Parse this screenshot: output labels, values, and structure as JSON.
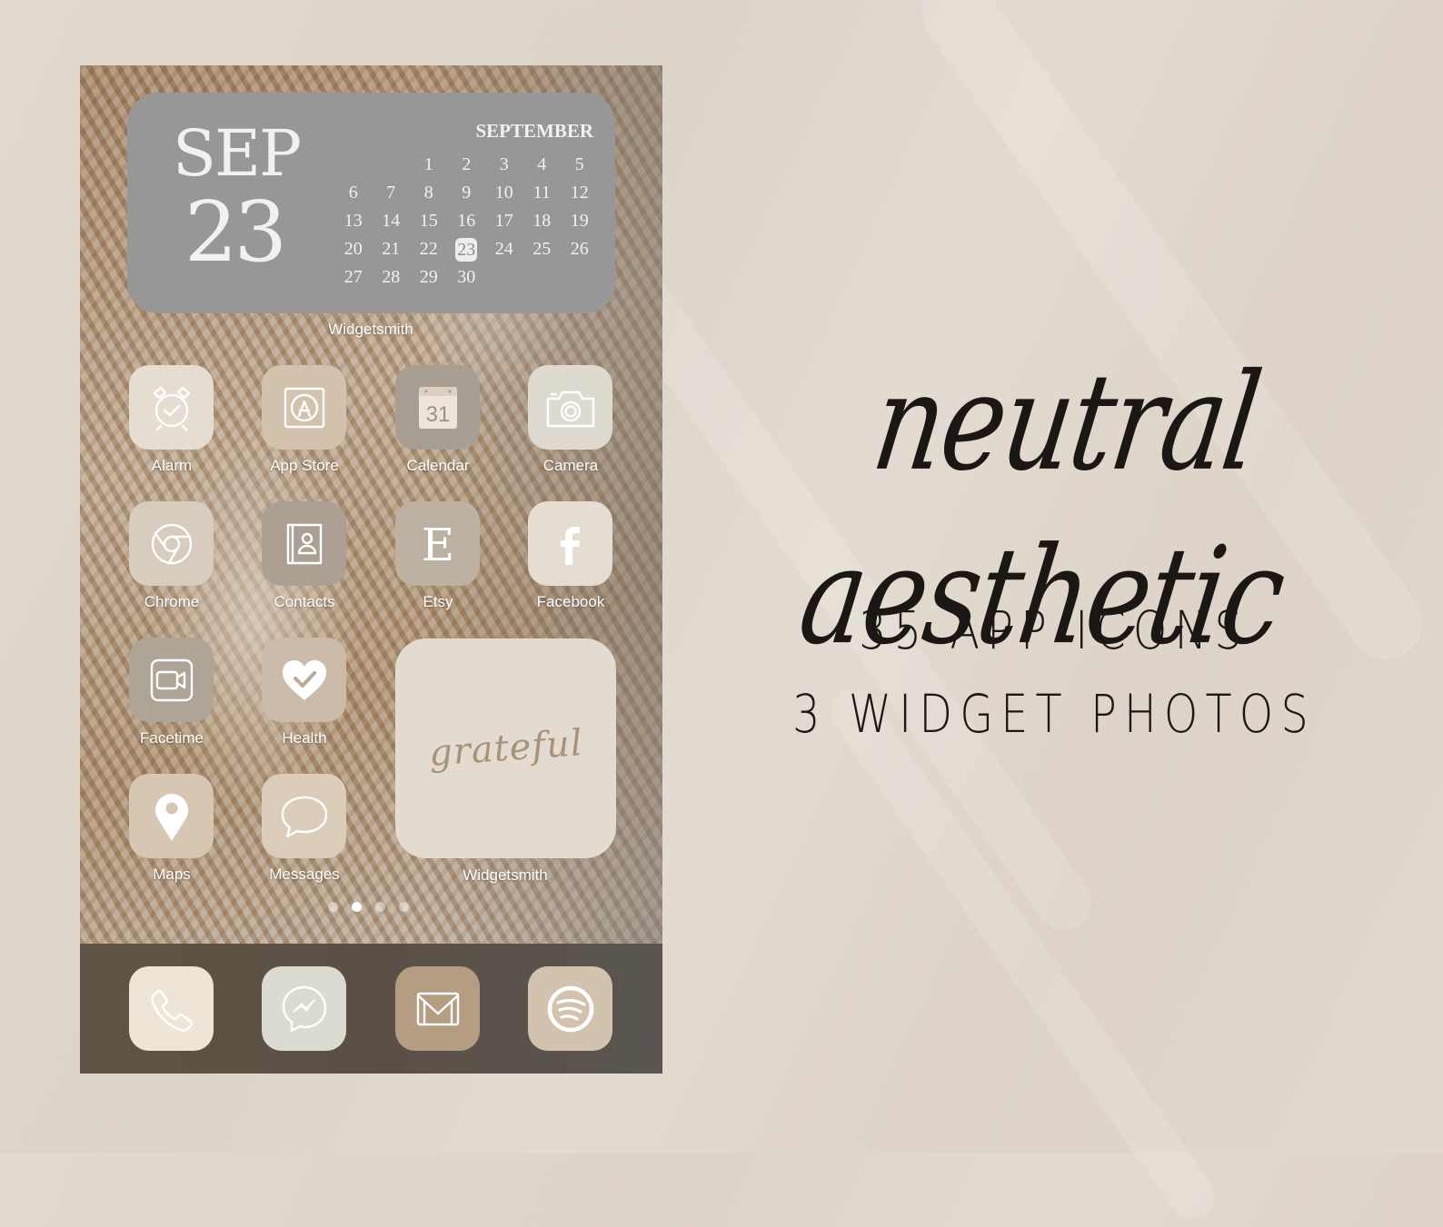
{
  "calendar_widget": {
    "month_short": "SEP",
    "day": "23",
    "month_long": "SEPTEMBER",
    "leading_blanks": 2,
    "days": [
      "1",
      "2",
      "3",
      "4",
      "5",
      "6",
      "7",
      "8",
      "9",
      "10",
      "11",
      "12",
      "13",
      "14",
      "15",
      "16",
      "17",
      "18",
      "19",
      "20",
      "21",
      "22",
      "23",
      "24",
      "25",
      "26",
      "27",
      "28",
      "29",
      "30"
    ],
    "today": "23",
    "label": "Widgetsmith"
  },
  "apps": [
    {
      "label": "Alarm",
      "icon": "alarm-clock-icon",
      "color": "#e6ddd2"
    },
    {
      "label": "App Store",
      "icon": "app-store-icon",
      "color": "#d3c2ac"
    },
    {
      "label": "Calendar",
      "icon": "calendar-icon",
      "color": "#a89f94",
      "glyph": "31"
    },
    {
      "label": "Camera",
      "icon": "camera-icon",
      "color": "#dedad0"
    },
    {
      "label": "Chrome",
      "icon": "chrome-icon",
      "color": "#d7ccbe"
    },
    {
      "label": "Contacts",
      "icon": "contacts-book-icon",
      "color": "#aba093"
    },
    {
      "label": "Etsy",
      "icon": "etsy-icon",
      "color": "#bcb1a3",
      "glyph": "E"
    },
    {
      "label": "Facebook",
      "icon": "facebook-icon",
      "color": "#e6ddd2",
      "glyph": "f"
    },
    {
      "label": "Facetime",
      "icon": "video-camera-icon",
      "color": "#aea596"
    },
    {
      "label": "Health",
      "icon": "heart-check-icon",
      "color": "#cbbba8"
    },
    {
      "label": "Maps",
      "icon": "map-pin-icon",
      "color": "#d7c6b1"
    },
    {
      "label": "Messages",
      "icon": "speech-bubble-icon",
      "color": "#dccdbb"
    }
  ],
  "quote_widget": {
    "text": "grateful",
    "label": "Widgetsmith"
  },
  "page_dots": {
    "count": 4,
    "active_index": 1
  },
  "dock": [
    {
      "name": "Phone",
      "icon": "phone-icon",
      "color": "#eee4d8"
    },
    {
      "name": "Messenger",
      "icon": "messenger-icon",
      "color": "#dcdbd1"
    },
    {
      "name": "Gmail",
      "icon": "mail-icon",
      "color": "#b59d82"
    },
    {
      "name": "Spotify",
      "icon": "spotify-icon",
      "color": "#d3c3ae"
    }
  ],
  "promo": {
    "title": "neutral aesthetic",
    "line1": "35 APP ICONS",
    "line2": "3 WIDGET PHOTOS"
  },
  "colors": {
    "background": "#e0d8ce",
    "calendar_widget": "#979797",
    "dock": "#5d5348",
    "text_dark": "#1a1714"
  }
}
